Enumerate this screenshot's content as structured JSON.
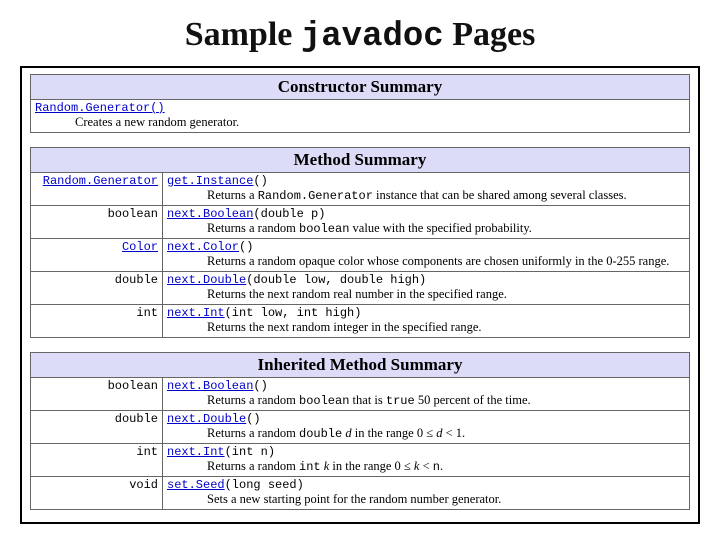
{
  "title": {
    "prefix": "Sample ",
    "javadoc": "javadoc",
    "suffix": " Pages"
  },
  "sections": {
    "constructor": {
      "heading": "Constructor Summary",
      "row": {
        "sig": "Random.Generator()",
        "desc": "Creates a new random generator."
      }
    },
    "method": {
      "heading": "Method Summary",
      "rows": [
        {
          "ret_link": "Random.Generator",
          "name": "get.Instance",
          "args": "()",
          "desc_pre": "Returns a ",
          "desc_code": "Random.Generator",
          "desc_post": " instance that can be shared among several classes."
        },
        {
          "ret": "boolean",
          "name": "next.Boolean",
          "args": "(double p)",
          "desc_pre": "Returns a random ",
          "desc_code": "boolean",
          "desc_post": " value with the specified probability."
        },
        {
          "ret_link": "Color",
          "name": "next.Color",
          "args": "()",
          "desc_plain": "Returns a random opaque color whose components are chosen uniformly in the 0-255 range."
        },
        {
          "ret": "double",
          "name": "next.Double",
          "args": "(double low, double high)",
          "desc_plain": "Returns the next random real number in the specified range."
        },
        {
          "ret": "int",
          "name": "next.Int",
          "args": "(int low, int high)",
          "desc_plain": "Returns the next random integer in the specified range."
        }
      ]
    },
    "inherited": {
      "heading": "Inherited Method Summary",
      "rows": [
        {
          "ret": "boolean",
          "name": "next.Boolean",
          "args": "()",
          "desc_pre": "Returns a random ",
          "desc_code": "boolean",
          "desc_mid": " that is ",
          "desc_code2": "true",
          "desc_post": " 50 percent of the time."
        },
        {
          "ret": "double",
          "name": "next.Double",
          "args": "()",
          "desc_pre": "Returns a random ",
          "desc_code": "double",
          "desc_html": " <i>d</i> in the range 0 ≤ <i>d</i> < 1."
        },
        {
          "ret": "int",
          "name": "next.Int",
          "args": "(int n)",
          "desc_pre": "Returns a random ",
          "desc_code": "int",
          "desc_html": " <i>k</i> in the range 0 ≤ <i>k</i> < "
        },
        {
          "ret": "void",
          "name": "set.Seed",
          "args": "(long seed)",
          "desc_plain": "Sets a new starting point for the random number generator."
        }
      ],
      "n_code": "n",
      "period": "."
    }
  }
}
